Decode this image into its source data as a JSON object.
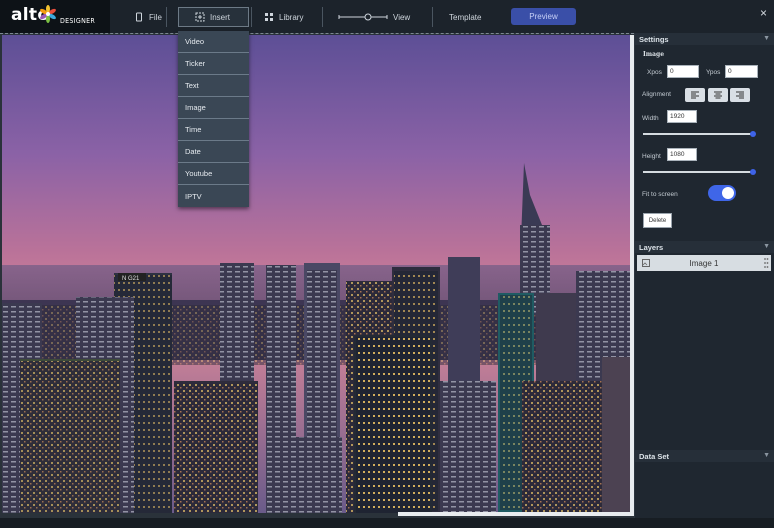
{
  "brand": {
    "name": "alto",
    "subtitle": "DESIGNER"
  },
  "menu": {
    "file": "File",
    "insert": "Insert",
    "library": "Library",
    "view": "View",
    "template": "Template",
    "preview": "Preview",
    "close": "×"
  },
  "insert_menu": [
    "Video",
    "Ticker",
    "Text",
    "Image",
    "Time",
    "Date",
    "Youtube",
    "IPTV"
  ],
  "settings": {
    "header": "Settings",
    "element_title": "Image",
    "xpos_label": "Xpos",
    "xpos_value": "0",
    "ypos_label": "Ypos",
    "ypos_value": "0",
    "alignment_label": "Alignment",
    "width_label": "Width",
    "width_value": "1920",
    "width_slider_level": 1.0,
    "height_label": "Height",
    "height_value": "1080",
    "height_slider_level": 1.0,
    "fit_label": "Fit to screen",
    "fit_on": true,
    "delete_label": "Delete"
  },
  "layers": {
    "header": "Layers",
    "items": [
      "Image 1"
    ]
  },
  "dataset": {
    "header": "Data Set"
  },
  "colors": {
    "accent": "#3f66e8",
    "preview": "#3a4fa8",
    "panel": "#1f2730"
  },
  "icons": [
    "file-icon",
    "insert-icon",
    "library-icon",
    "view-slider-icon",
    "close-icon",
    "align-left-icon",
    "align-center-icon",
    "align-right-icon",
    "image-icon",
    "drag-handle-icon",
    "chevron-down-icon"
  ]
}
